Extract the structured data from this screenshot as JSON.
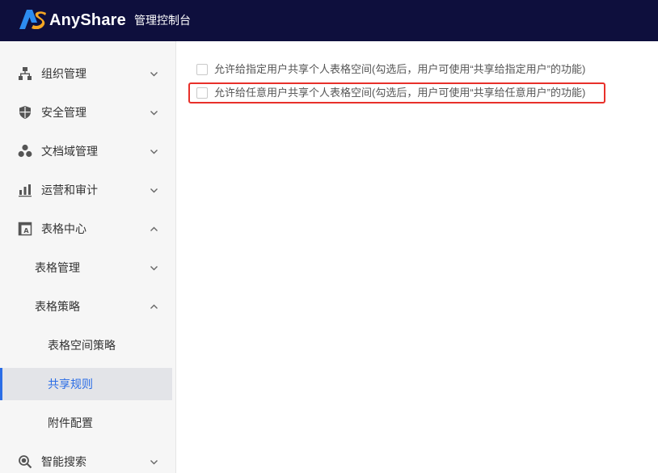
{
  "header": {
    "brand": "AnyShare",
    "console_title": "管理控制台",
    "colors": {
      "bar": "#0e0f3d",
      "logo_left": "#2d8cf0",
      "logo_right": "#f5a623"
    }
  },
  "sidebar": {
    "items": [
      {
        "label": "组织管理",
        "icon": "org-tree-icon",
        "expanded": false
      },
      {
        "label": "安全管理",
        "icon": "shield-icon",
        "expanded": false
      },
      {
        "label": "文档域管理",
        "icon": "cubes-icon",
        "expanded": false
      },
      {
        "label": "运营和审计",
        "icon": "bar-chart-icon",
        "expanded": false
      },
      {
        "label": "表格中心",
        "icon": "sheet-icon",
        "expanded": true
      },
      {
        "label": "表格管理",
        "expanded": false
      },
      {
        "label": "表格策略",
        "expanded": true
      },
      {
        "label": "表格空间策略"
      },
      {
        "label": "共享规则",
        "active": true
      },
      {
        "label": "附件配置"
      },
      {
        "label": "智能搜索",
        "icon": "search-icon",
        "expanded": false
      }
    ],
    "active_color": "#2b6de6"
  },
  "main": {
    "options": [
      {
        "label": "允许给指定用户共享个人表格空间(勾选后，用户可使用“共享给指定用户”的功能)",
        "checked": false
      },
      {
        "label": "允许给任意用户共享个人表格空间(勾选后，用户可使用“共享给任意用户”的功能)",
        "checked": false,
        "highlighted": true
      }
    ],
    "highlight_color": "#e8302a"
  }
}
